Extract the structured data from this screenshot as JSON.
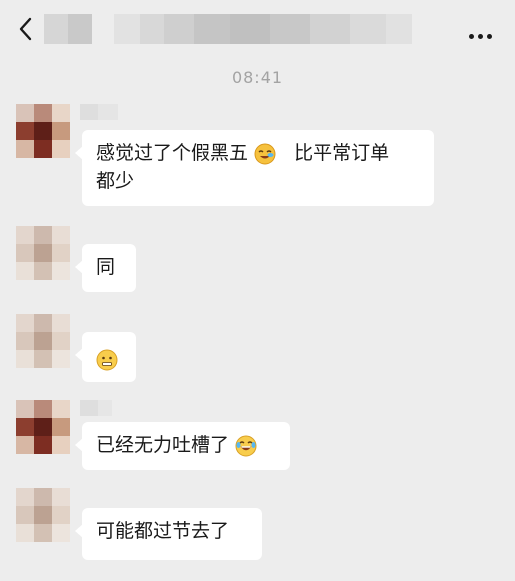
{
  "header": {
    "back_icon": "chevron-left-icon",
    "more_icon": "more-dots-icon"
  },
  "chat": {
    "timestamp": "08:41",
    "messages": [
      {
        "text_before": "感觉过了个假黑五",
        "emoji": "sticker-laughing-emoji",
        "text_after": "比平常订单",
        "text_line2": "都少"
      },
      {
        "text": "同"
      },
      {
        "emoji": "neutral-face-emoji"
      },
      {
        "text": "已经无力吐槽了",
        "emoji": "laughing-tears-emoji"
      },
      {
        "text": "可能都过节去了"
      }
    ]
  },
  "colors": {
    "background": "#ededed",
    "bubble": "#ffffff",
    "text": "#1a1a1a",
    "timestamp": "#a3a3a3"
  }
}
